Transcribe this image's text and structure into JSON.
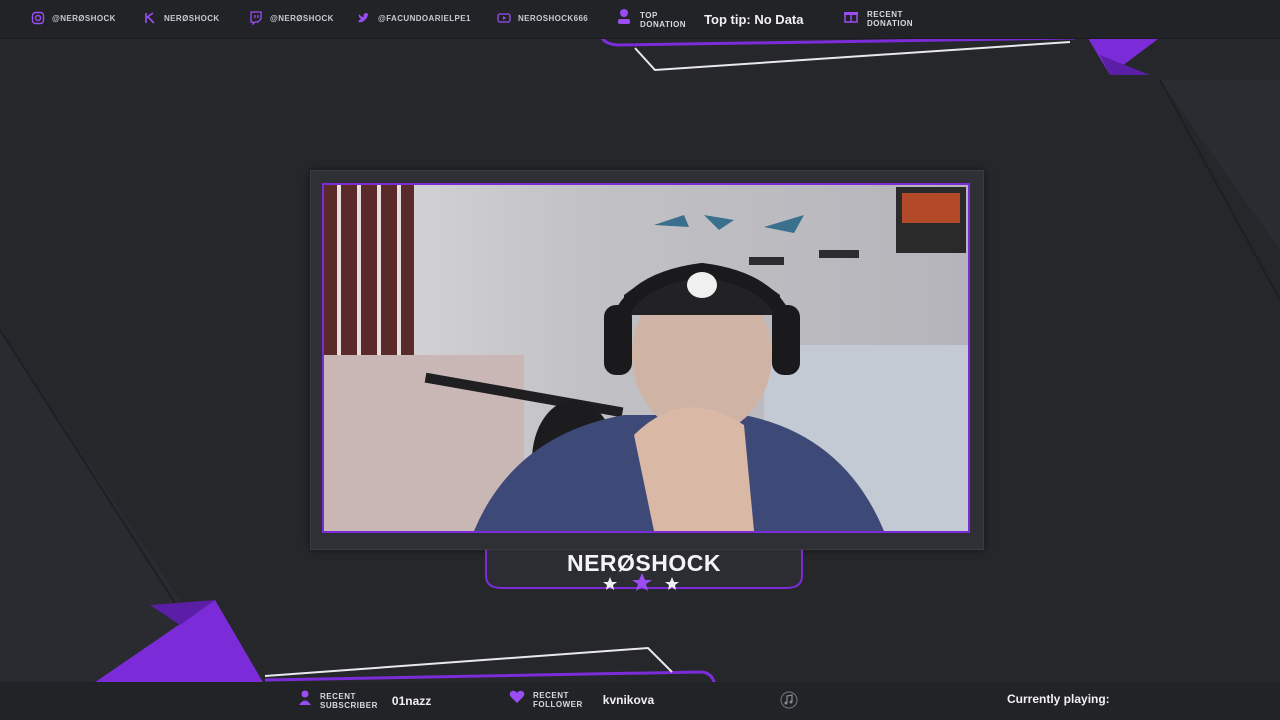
{
  "colors": {
    "accent": "#7b2cd8",
    "accent_light": "#9a4df2",
    "background": "#26272b",
    "bar": "#222327"
  },
  "socials": [
    {
      "icon": "instagram-icon",
      "handle": "@NERØSHOCK"
    },
    {
      "icon": "kick-icon",
      "handle": "NERØSHOCK"
    },
    {
      "icon": "twitch-icon",
      "handle": "@NERØSHOCK"
    },
    {
      "icon": "twitter-icon",
      "handle": "@FACUNDOARIELPE1"
    },
    {
      "icon": "youtube-icon",
      "handle": "NEROSHOCK666"
    }
  ],
  "top_donation": {
    "label_line1": "TOP",
    "label_line2": "DONATION",
    "text": "Top tip: No Data"
  },
  "recent_donation": {
    "label_line1": "RECENT",
    "label_line2": "DONATION"
  },
  "streamer_name": "NERØSHOCK",
  "recent_subscriber": {
    "label_line1": "RECENT",
    "label_line2": "SUBSCRIBER",
    "value": "01nazz"
  },
  "recent_follower": {
    "label_line1": "RECENT",
    "label_line2": "FOLLOWER",
    "value": "kvnikova"
  },
  "now_playing": {
    "label": "Currently playing:"
  }
}
